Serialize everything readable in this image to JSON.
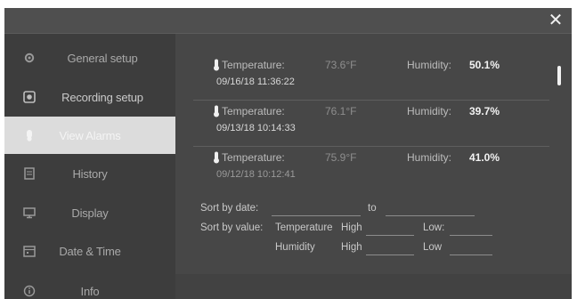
{
  "window": {
    "close_glyph": "✕"
  },
  "sidebar": {
    "items": [
      {
        "label": "General setup",
        "icon": "gear-icon"
      },
      {
        "label": "Recording setup",
        "icon": "record-icon"
      },
      {
        "label": "View Alarms",
        "icon": "alarm-icon",
        "active": true
      },
      {
        "label": "History",
        "icon": "document-icon"
      },
      {
        "label": "Display",
        "icon": "monitor-icon"
      },
      {
        "label": "Date & Time",
        "icon": "calendar-icon"
      },
      {
        "label": "Info",
        "icon": "info-icon"
      }
    ]
  },
  "alarms": {
    "rows": [
      {
        "temp_label": "Temperature:",
        "temp_value": "73.6°F",
        "hum_label": "Humidity:",
        "hum_value": "50.1%",
        "timestamp": "09/16/18 11:36:22"
      },
      {
        "temp_label": "Temperature:",
        "temp_value": "76.1°F",
        "hum_label": "Humidity:",
        "hum_value": "39.7%",
        "timestamp": "09/13/18 10:14:33"
      },
      {
        "temp_label": "Temperature:",
        "temp_value": "75.9°F",
        "hum_label": "Humidity:",
        "hum_value": "41.0%",
        "timestamp": "09/12/18 10:12:41"
      }
    ]
  },
  "filters": {
    "sort_date_label": "Sort by date:",
    "to_label": "to",
    "sort_value_label": "Sort by value:",
    "temperature_label": "Temperature",
    "humidity_label": "Humidity",
    "high_label": "High",
    "low_label": "Low:",
    "low_label_2": "Low"
  },
  "colors": {
    "panel_bg": "#474747",
    "sidebar_bg": "#3d3d3d",
    "active_item_bg": "#dcdcdc"
  }
}
